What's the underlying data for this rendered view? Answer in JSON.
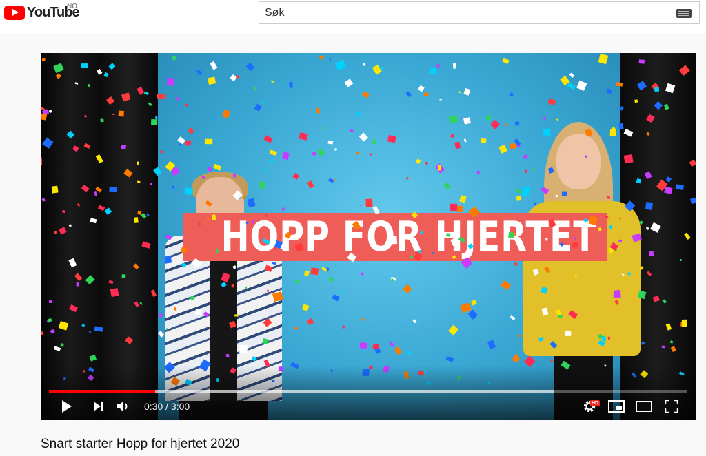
{
  "masthead": {
    "logo_text": "YouTube",
    "region_code": "NO",
    "search_placeholder": "Søk",
    "keyboard_icon": "keyboard-icon"
  },
  "player": {
    "overlay_text": "HOPP FOR HJERTET",
    "time_current": "0:30",
    "time_total": "3:00",
    "time_display": "0:30 / 3:00",
    "progress_played": 0.1667,
    "progress_loaded": 0.79,
    "hd_badge": "HD",
    "icons": [
      "play-icon",
      "next-icon",
      "volume-icon",
      "settings-icon",
      "miniplayer-icon",
      "theater-mode-icon",
      "fullscreen-icon"
    ]
  },
  "video": {
    "title": "Snart starter Hopp for hjertet 2020"
  },
  "colors": {
    "brand_red": "#ff0000",
    "banner": "#ef5d58",
    "backdrop": "#3aa8d4"
  }
}
